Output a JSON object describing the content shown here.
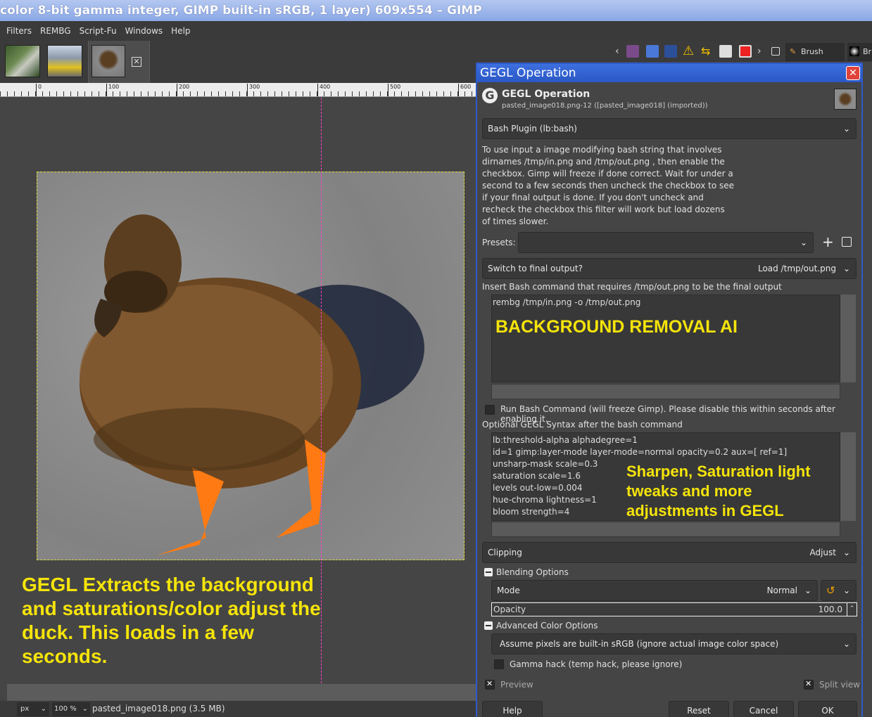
{
  "window": {
    "title": "color 8-bit gamma integer, GIMP built-in sRGB, 1 layer) 609x554 – GIMP"
  },
  "menubar": {
    "items": [
      "Filters",
      "REMBG",
      "Script-Fu",
      "Windows",
      "Help"
    ]
  },
  "ruler": {
    "labels": [
      "0",
      "100",
      "200",
      "300",
      "400",
      "500",
      "600"
    ]
  },
  "dock": {
    "brush_editor_tab": "Brush Editor",
    "second_tab": "Br"
  },
  "canvas": {
    "caption": "GEGL Extracts the background and saturations/color adjust the duck. This loads in a few seconds."
  },
  "statusbar": {
    "unit": "px",
    "zoom": "100 %",
    "text": "pasted_image018.png (3.5 MB)"
  },
  "dialog": {
    "title": "GEGL Operation",
    "close_glyph": "✕",
    "header_title": "GEGL Operation",
    "header_subtitle": "pasted_image018.png-12 ([pasted_image018] (imported))",
    "operation": "Bash Plugin (lb:bash)",
    "description": "To use input a image modifying bash string that involves dirnames /tmp/in.png and /tmp/out.png , then enable the checkbox. Gimp will freeze if done correct. Wait for under a second to a few seconds  then uncheck the checkbox to see if your final output is done. If you don't uncheck and recheck the checkbox this filter will work but load dozens of times slower.",
    "presets_label": "Presets:",
    "switch_label": "Switch to final output?",
    "switch_value": "Load /tmp/out.png",
    "bash_label": "Insert Bash command that requires /tmp/out.png to be the final output",
    "bash_command": "rembg /tmp/in.png -o /tmp/out.png",
    "bash_overlay": "BACKGROUND REMOVAL AI",
    "run_label": "Run Bash Command (will freeze Gimp). Please disable this within seconds after enabling it.",
    "gegl_label": "Optional GEGL Syntax after the bash command",
    "gegl_lines": [
      "lb:threshold-alpha alphadegree=1",
      "id=1 gimp:layer-mode layer-mode=normal opacity=0.2 aux=[ ref=1]",
      "unsharp-mask scale=0.3",
      "saturation scale=1.6",
      "levels out-low=0.004",
      "hue-chroma lightness=1",
      "bloom strength=4"
    ],
    "gegl_overlay": "Sharpen, Saturation light tweaks and more adjustments in GEGL",
    "clipping_label": "Clipping",
    "clipping_value": "Adjust",
    "blending_label": "Blending Options",
    "mode_label": "Mode",
    "mode_value": "Normal",
    "opacity_label": "Opacity",
    "opacity_value": "100.0",
    "advanced_label": "Advanced Color Options",
    "colorspace_value": "Assume pixels are built-in sRGB (ignore actual image color space)",
    "gamma_label": "Gamma hack (temp hack, please ignore)",
    "preview_label": "Preview",
    "split_label": "Split view",
    "buttons": {
      "help": "Help",
      "reset": "Reset",
      "cancel": "Cancel",
      "ok": "OK"
    }
  },
  "colors": {
    "accent_blue": "#2d5ac8",
    "annotation_yellow": "#f5e40a",
    "guide_magenta": "#ff3fd0"
  }
}
